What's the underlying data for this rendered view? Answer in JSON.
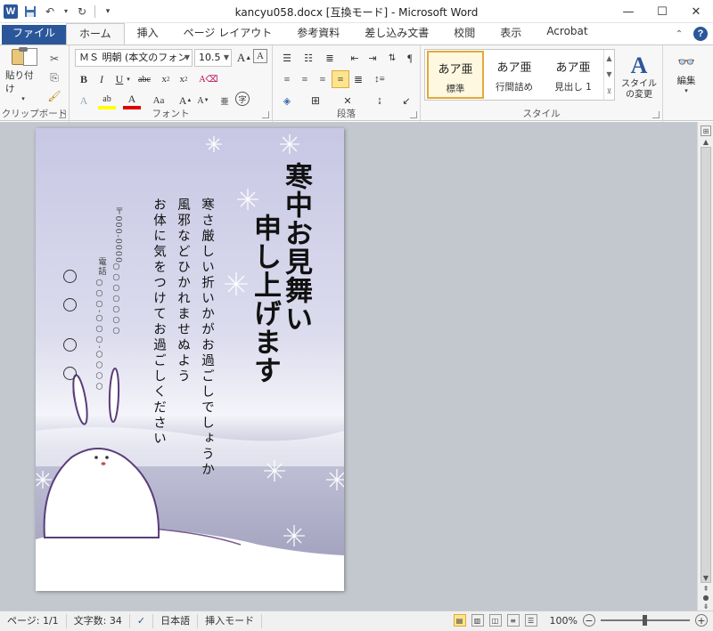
{
  "window": {
    "title": "kancyu058.docx [互換モード] - Microsoft Word",
    "app_icon": "W"
  },
  "tabs": [
    {
      "label": "ファイル"
    },
    {
      "label": "ホーム"
    },
    {
      "label": "挿入"
    },
    {
      "label": "ページ レイアウト"
    },
    {
      "label": "参考資料"
    },
    {
      "label": "差し込み文書"
    },
    {
      "label": "校閲"
    },
    {
      "label": "表示"
    },
    {
      "label": "Acrobat"
    }
  ],
  "ribbon": {
    "clipboard": {
      "label": "クリップボード",
      "paste_label": "貼り付け"
    },
    "font": {
      "label": "フォント",
      "font_name": "ＭＳ 明朝 (本文のフォン",
      "font_size": "10.5"
    },
    "paragraph": {
      "label": "段落"
    },
    "styles": {
      "label": "スタイル",
      "items": [
        {
          "sample": "あア亜",
          "name": "標準"
        },
        {
          "sample": "あア亜",
          "name": "行間詰め"
        },
        {
          "sample": "あア亜",
          "name": "見出し 1"
        }
      ],
      "change_label": "スタイルの変更"
    },
    "editing": {
      "label": "編集"
    }
  },
  "document": {
    "title_col1": "寒中お見舞い",
    "title_col2": "申し上げます",
    "body_col1": "寒さ厳しい折いかがお過ごしでしょうか",
    "body_col2": "風邪などひかれませぬよう",
    "body_col3": "お体に気をつけてお過ごしください",
    "postal": "〒000-0000",
    "address_dots": "○○○○○○○",
    "phone_label": "電話",
    "phone_dots": "○○○-○○○-○○○○"
  },
  "statusbar": {
    "page": "ページ: 1/1",
    "word_count": "文字数: 34",
    "language": "日本語",
    "mode": "挿入モード",
    "zoom": "100%"
  }
}
